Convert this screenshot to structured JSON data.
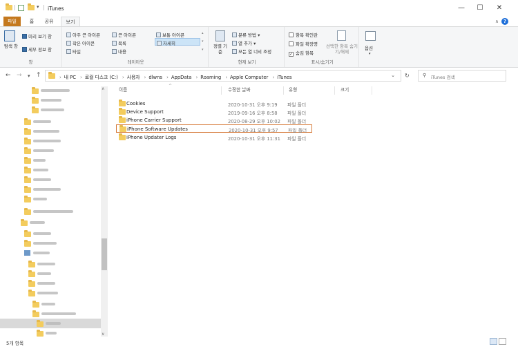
{
  "window": {
    "title": "iTunes",
    "minimize": "—",
    "maximize": "☐",
    "close": "✕"
  },
  "tabs": [
    "파일",
    "홈",
    "공유",
    "보기"
  ],
  "help": "?",
  "ribbon": {
    "pane_group": {
      "nav_pane": "탐색 창",
      "preview_pane": "미리 보기 창",
      "details_pane": "세부 정보 창",
      "label": "창"
    },
    "layout_group": {
      "items": [
        "아주 큰 아이콘",
        "큰 아이콘",
        "보통 아이콘",
        "작은 아이콘",
        "목록",
        "자세히",
        "타일",
        "내용"
      ],
      "label": "레이아웃"
    },
    "current_view": {
      "sort_by": "정렬 기준",
      "group_by": "분류 방법",
      "add_columns": "열 추가",
      "fit_columns": "모든 열 너비 조정",
      "label": "현재 보기"
    },
    "show_hide": {
      "item_checkboxes": "항목 확인란",
      "file_extensions": "파일 확장명",
      "hidden_items": "숨김 항목",
      "hide_selected": "선택한 항목 숨기기/해제",
      "label": "표시/숨기기"
    },
    "options": "옵션"
  },
  "address": {
    "crumbs": [
      "내 PC",
      "로컬 디스크 (C:)",
      "사용자",
      "dlwns",
      "AppData",
      "Roaming",
      "Apple Computer",
      "iTunes"
    ],
    "search_placeholder": "iTunes 검색"
  },
  "columns": [
    "이름",
    "수정한 날짜",
    "유형",
    "크기"
  ],
  "files": [
    {
      "name": "Cookies",
      "date": "2020-10-31 오후 9:19",
      "type": "파일 폴더"
    },
    {
      "name": "Device Support",
      "date": "2019-09-16 오후 8:58",
      "type": "파일 폴더"
    },
    {
      "name": "iPhone Carrier Support",
      "date": "2020-08-29 오후 10:02",
      "type": "파일 폴더"
    },
    {
      "name": "iPhone Software Updates",
      "date": "2020-10-31 오후 9:57",
      "type": "파일 폴더"
    },
    {
      "name": "iPhone Updater Logs",
      "date": "2020-10-31 오후 11:31",
      "type": "파일 폴더"
    }
  ],
  "status": {
    "count": "5개 항목"
  }
}
